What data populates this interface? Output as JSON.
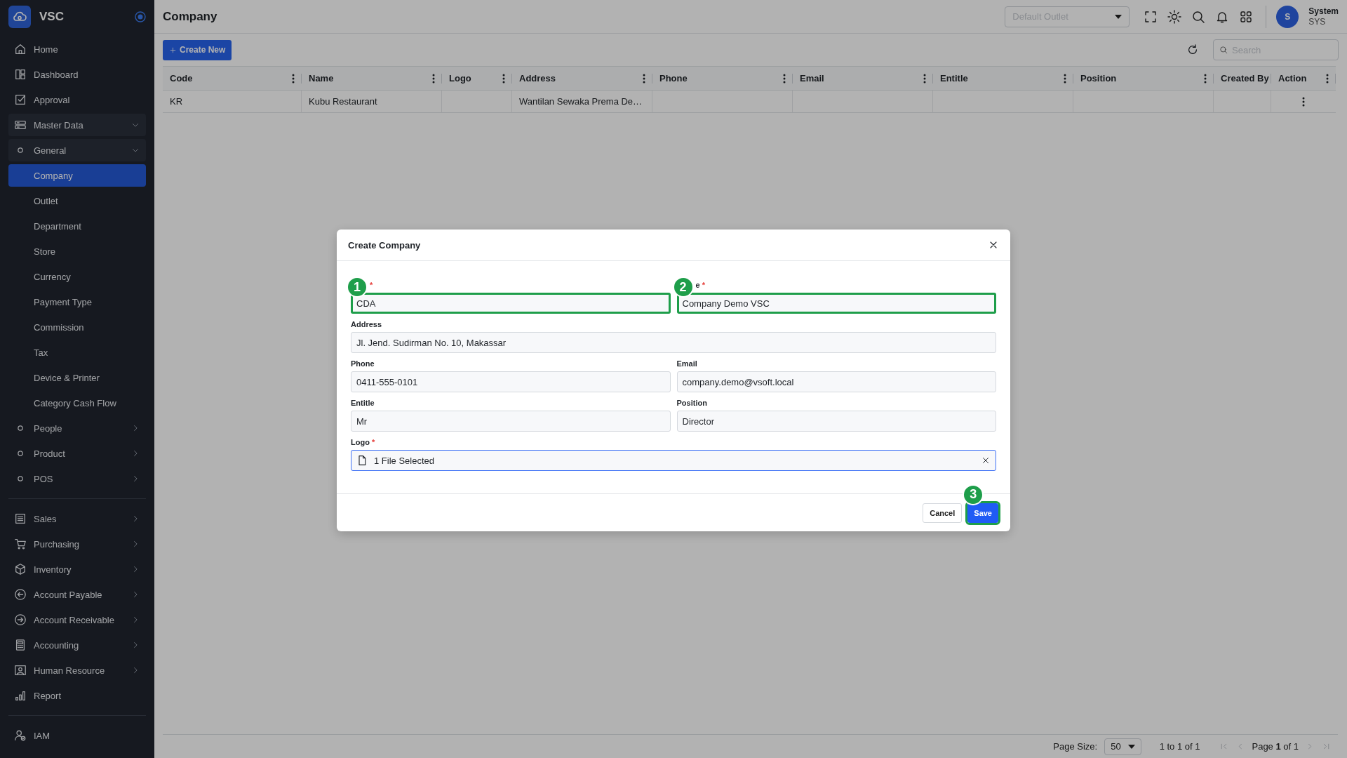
{
  "sidebar": {
    "brand": "VSC",
    "sections": [
      {
        "items": [
          {
            "label": "Home",
            "selected": false
          },
          {
            "label": "Dashboard",
            "selected": false
          },
          {
            "label": "Approval",
            "selected": false
          },
          {
            "label": "Master Data",
            "selected": false,
            "expanded": true,
            "children": [
              {
                "label": "General",
                "selected": false,
                "expanded": true,
                "children": [
                  {
                    "label": "Company",
                    "selected": true
                  },
                  {
                    "label": "Outlet",
                    "selected": false
                  },
                  {
                    "label": "Department",
                    "selected": false
                  },
                  {
                    "label": "Store",
                    "selected": false
                  },
                  {
                    "label": "Currency",
                    "selected": false
                  },
                  {
                    "label": "Payment Type",
                    "selected": false
                  },
                  {
                    "label": "Commission",
                    "selected": false
                  },
                  {
                    "label": "Tax",
                    "selected": false
                  },
                  {
                    "label": "Device & Printer",
                    "selected": false
                  },
                  {
                    "label": "Category Cash Flow",
                    "selected": false
                  }
                ]
              },
              {
                "label": "People",
                "selected": false,
                "expanded": false
              },
              {
                "label": "Product",
                "selected": false,
                "expanded": false
              },
              {
                "label": "POS",
                "selected": false,
                "expanded": false
              }
            ]
          }
        ]
      },
      {
        "items": [
          {
            "label": "Sales",
            "selected": false,
            "expanded": false
          },
          {
            "label": "Purchasing",
            "selected": false,
            "expanded": false
          },
          {
            "label": "Inventory",
            "selected": false,
            "expanded": false
          },
          {
            "label": "Account Payable",
            "selected": false,
            "expanded": false
          },
          {
            "label": "Account Receivable",
            "selected": false,
            "expanded": false
          },
          {
            "label": "Accounting",
            "selected": false,
            "expanded": false
          },
          {
            "label": "Human Resource",
            "selected": false,
            "expanded": false
          },
          {
            "label": "Report",
            "selected": false
          }
        ]
      },
      {
        "items": [
          {
            "label": "IAM",
            "selected": false
          }
        ]
      }
    ]
  },
  "topbar": {
    "title": "Company",
    "outlet_placeholder": "Default Outlet",
    "user": {
      "avatar": "S",
      "name": "System",
      "role": "SYS"
    }
  },
  "toolbar": {
    "create_button": "Create New",
    "search_placeholder": "Search"
  },
  "table": {
    "columns": [
      "Code",
      "Name",
      "Logo",
      "Address",
      "Phone",
      "Email",
      "Entitle",
      "Position",
      "Created By",
      "Action"
    ],
    "rows": [
      {
        "code": "KR",
        "name": "Kubu Restaurant",
        "address": "Wantilan Sewaka Prema De…"
      }
    ]
  },
  "pager": {
    "page_size_label": "Page Size:",
    "page_size": "50",
    "range": "1 to 1 of 1",
    "page": "Page **1** of 1"
  },
  "modal": {
    "title": "Create Company",
    "fields": [
      {
        "kind": "text",
        "required_mark": "*",
        "value": "CDA",
        "marker": "1"
      },
      {
        "kind": "text",
        "label": "e",
        "required_mark": "*",
        "value": "Company Demo VSC",
        "marker": "2"
      },
      {
        "kind": "text",
        "label": "Address",
        "value": "Jl. Jend. Sudirman No. 10, Makassar",
        "full_width": true
      },
      {
        "kind": "text",
        "label": "Phone",
        "value": "0411-555-0101"
      },
      {
        "kind": "text",
        "label": "Email",
        "value": "company.demo@vsoft.local"
      },
      {
        "kind": "text",
        "label": "Entitle",
        "value": "Mr"
      },
      {
        "kind": "text",
        "label": "Position",
        "value": "Director"
      },
      {
        "kind": "file",
        "label": "Logo",
        "required_mark": "*",
        "value": "1 File Selected",
        "full_width": true,
        "focused": true
      }
    ],
    "buttons": [
      {
        "label": "Cancel",
        "kind": "secondary"
      },
      {
        "label": "Save",
        "kind": "primary",
        "marker": "3"
      }
    ]
  }
}
